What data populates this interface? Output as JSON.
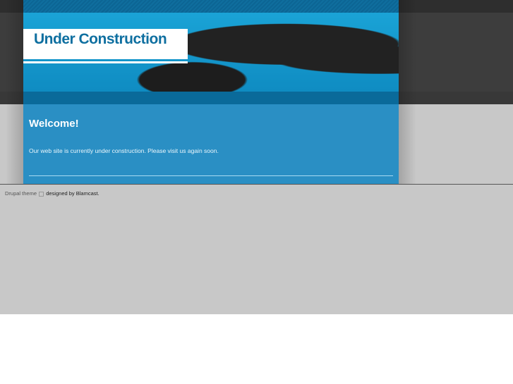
{
  "site": {
    "title": "Under Construction"
  },
  "content": {
    "heading": "Welcome!",
    "message": "Our web site is currently under construction. Please visit us again soon."
  },
  "footer": {
    "link_text": "Drupal theme",
    "designed_by": "designed by Blamcast."
  },
  "colors": {
    "content_bg": "#2a8fc4",
    "title": "#0e6fa0"
  }
}
